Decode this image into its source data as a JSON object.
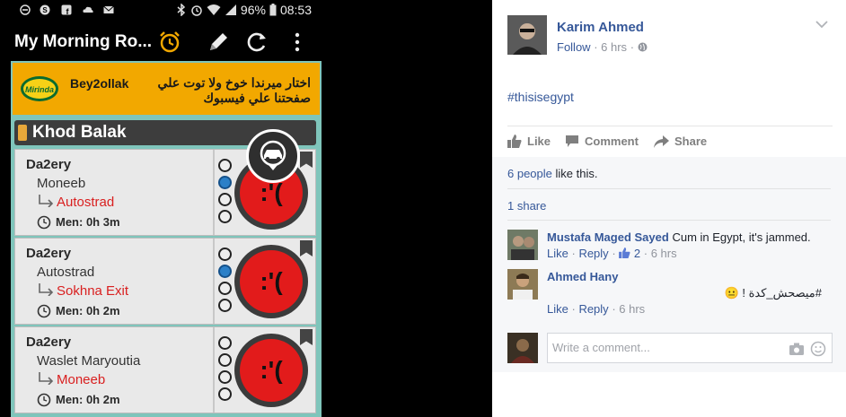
{
  "status_bar": {
    "battery": "96%",
    "time": "08:53"
  },
  "app": {
    "title": "My Morning Ro...",
    "ad": {
      "brand": "Bey2ollak",
      "logo_text": "Mirinda",
      "text": "اختار ميرندا خوخ ولا توت علي صفحتنا علي فيسبوك"
    },
    "section_title": "Khod Balak",
    "routes": [
      {
        "from": "Da2ery",
        "via": "Moneeb",
        "to": "Autostrad",
        "time": "Men: 0h 3m",
        "face": ":'(",
        "selected_radio": 1
      },
      {
        "from": "Da2ery",
        "via": "Autostrad",
        "to": "Sokhna Exit",
        "time": "Men: 0h 2m",
        "face": ":'(",
        "selected_radio": 1
      },
      {
        "from": "Da2ery",
        "via": "Waslet Maryoutia",
        "to": "Moneeb",
        "time": "Men: 0h 2m",
        "face": ":'(",
        "selected_radio": -1
      }
    ]
  },
  "post": {
    "author": "Karim Ahmed",
    "follow": "Follow",
    "time_ago": "6 hrs",
    "text": "#thisisegypt",
    "actions": {
      "like": "Like",
      "comment": "Comment",
      "share": "Share"
    },
    "likes_link": "6 people",
    "likes_suffix": "like this.",
    "shares": "1 share",
    "comments": [
      {
        "author": "Mustafa Maged Sayed",
        "text": "Cum in Egypt, it's jammed.",
        "like": "Like",
        "reply": "Reply",
        "likes": "2",
        "time": "6 hrs"
      },
      {
        "author": "Ahmed Hany",
        "text": "#ميصحش_كدة ! 😐",
        "like": "Like",
        "reply": "Reply",
        "time": "6 hrs"
      }
    ],
    "comment_placeholder": "Write a comment..."
  },
  "colors": {
    "fb_blue": "#365899",
    "ad_orange": "#f2a800",
    "teal": "#7fc5bb",
    "alert_red": "#e21b1b",
    "route_dest_red": "#d92020"
  }
}
